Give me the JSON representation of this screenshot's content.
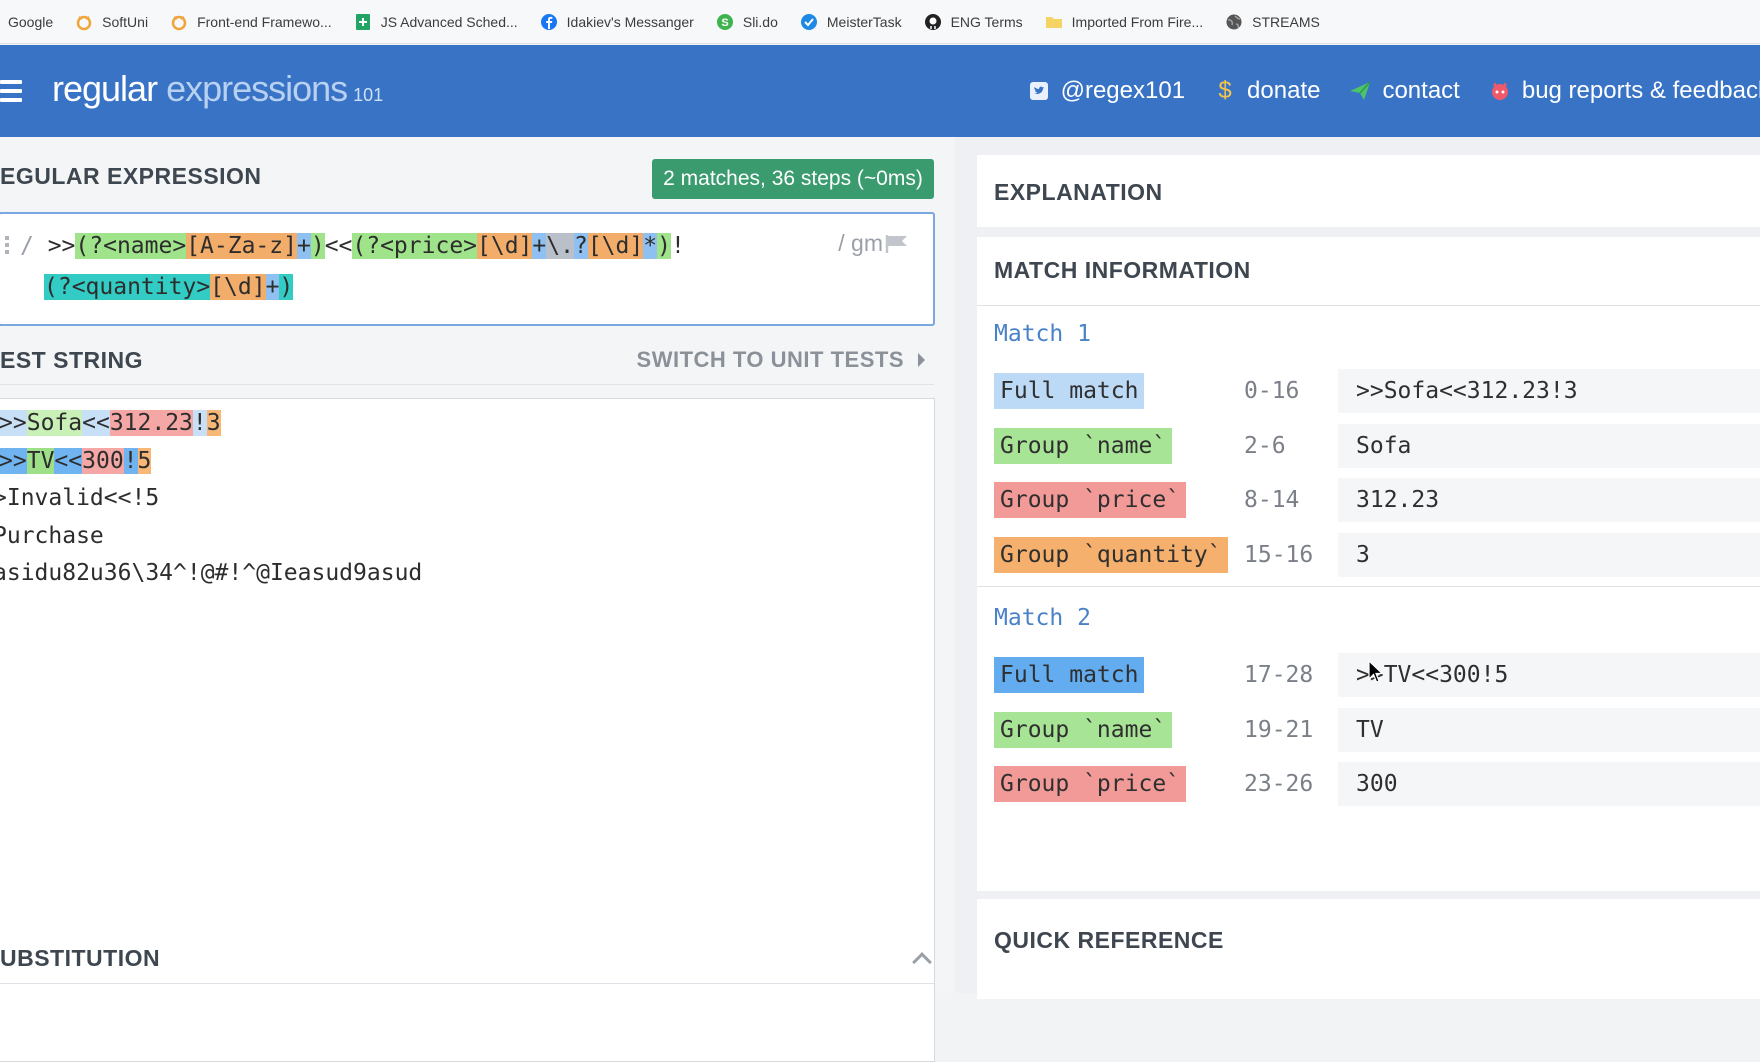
{
  "bookmarks": [
    {
      "label": "Google",
      "icon": "google-icon"
    },
    {
      "label": "SoftUni",
      "icon": "softuni-icon"
    },
    {
      "label": "Front-end Framewo...",
      "icon": "softuni-icon"
    },
    {
      "label": "JS Advanced Sched...",
      "icon": "sheets-icon"
    },
    {
      "label": "Idakiev's Messanger",
      "icon": "facebook-icon"
    },
    {
      "label": "Sli.do",
      "icon": "slido-icon"
    },
    {
      "label": "MeisterTask",
      "icon": "meistertask-icon"
    },
    {
      "label": "ENG Terms",
      "icon": "github-icon"
    },
    {
      "label": "Imported From Fire...",
      "icon": "folder-icon"
    },
    {
      "label": "STREAMS",
      "icon": "globe-icon"
    }
  ],
  "header": {
    "logo_main": "regular",
    "logo_light": " expressions",
    "logo_ver": "101",
    "nav": [
      {
        "label": "@regex101",
        "icon": "twitter-icon"
      },
      {
        "label": "donate",
        "icon": "dollar-icon"
      },
      {
        "label": "contact",
        "icon": "paper-plane-icon"
      },
      {
        "label": "bug reports & feedback",
        "icon": "github-cat-icon"
      }
    ]
  },
  "regex_section": {
    "title": "EGULAR EXPRESSION",
    "badge": "2 matches, 36 steps (~0ms)",
    "delim_open": "/",
    "flags": "/ gm"
  },
  "regex_tokens_line1": [
    {
      "t": " >>",
      "c": ""
    },
    {
      "t": "(?<name>",
      "c": "t-green"
    },
    {
      "t": "[A-Za-z]",
      "c": "t-orange"
    },
    {
      "t": "+",
      "c": "t-blue"
    },
    {
      "t": ")",
      "c": "t-green"
    },
    {
      "t": "<<",
      "c": ""
    },
    {
      "t": "(?<price>",
      "c": "t-green"
    },
    {
      "t": "[\\d]",
      "c": "t-orange"
    },
    {
      "t": "+",
      "c": "t-blue"
    },
    {
      "t": "\\.",
      "c": "t-grey"
    },
    {
      "t": "?",
      "c": "t-blue"
    },
    {
      "t": "[\\d]",
      "c": "t-orange"
    },
    {
      "t": "*",
      "c": "t-blue"
    },
    {
      "t": ")",
      "c": "t-green"
    },
    {
      "t": "!",
      "c": ""
    }
  ],
  "regex_tokens_line2": [
    {
      "t": "(?<quantity>",
      "c": "t-teal"
    },
    {
      "t": "[\\d]",
      "c": "t-orange"
    },
    {
      "t": "+",
      "c": "t-blue"
    },
    {
      "t": ")",
      "c": "t-teal"
    }
  ],
  "test_section": {
    "title": "EST STRING",
    "switch_label": "SWITCH TO UNIT TESTS"
  },
  "test_lines": [
    [
      {
        "t": ">",
        "c": "h-fullb"
      },
      {
        "t": ">",
        "c": "h-fullb"
      },
      {
        "t": "Sofa",
        "c": "h-name"
      },
      {
        "t": "<<",
        "c": "h-fullb"
      },
      {
        "t": "312.23",
        "c": "h-price"
      },
      {
        "t": "!",
        "c": "h-fullb"
      },
      {
        "t": "3",
        "c": "h-qty"
      }
    ],
    [
      {
        "t": ">",
        "c": "h-full2"
      },
      {
        "t": ">",
        "c": "h-full2"
      },
      {
        "t": "TV",
        "c": "h-name2"
      },
      {
        "t": "<<",
        "c": "h-full2"
      },
      {
        "t": "300",
        "c": "h-price"
      },
      {
        "t": "!",
        "c": "h-full2"
      },
      {
        "t": "5",
        "c": "h-qty"
      }
    ],
    [
      {
        "t": ">Invalid<<!5",
        "c": ""
      }
    ],
    [
      {
        "t": "Purchase",
        "c": ""
      }
    ],
    [
      {
        "t": "asidu82u36\\34^!@#!^@Ieasud9asud",
        "c": ""
      }
    ]
  ],
  "substitution_title": "UBSTITUTION",
  "explanation_title": "EXPLANATION",
  "match_info_title": "MATCH INFORMATION",
  "matches": [
    {
      "title": "Match 1",
      "rows": [
        {
          "label": "Full match",
          "cls": "l-full",
          "range": "0-16",
          "value": ">>Sofa<<312.23!3"
        },
        {
          "label": "Group `name`",
          "cls": "l-name",
          "range": "2-6",
          "value": "Sofa"
        },
        {
          "label": "Group `price`",
          "cls": "l-price",
          "range": "8-14",
          "value": "312.23"
        },
        {
          "label": "Group `quantity`",
          "cls": "l-qty",
          "range": "15-16",
          "value": "3"
        }
      ]
    },
    {
      "title": "Match 2",
      "rows": [
        {
          "label": "Full match",
          "cls": "l-full2",
          "range": "17-28",
          "value": ">>TV<<300!5"
        },
        {
          "label": "Group `name`",
          "cls": "l-name",
          "range": "19-21",
          "value": "TV"
        },
        {
          "label": "Group `price`",
          "cls": "l-price",
          "range": "23-26",
          "value": "300"
        }
      ]
    }
  ],
  "quick_ref_title": "QUICK REFERENCE",
  "colors": {
    "header": "#3873c6",
    "badge": "#3a9b6f",
    "match_title": "#4a82c8"
  }
}
